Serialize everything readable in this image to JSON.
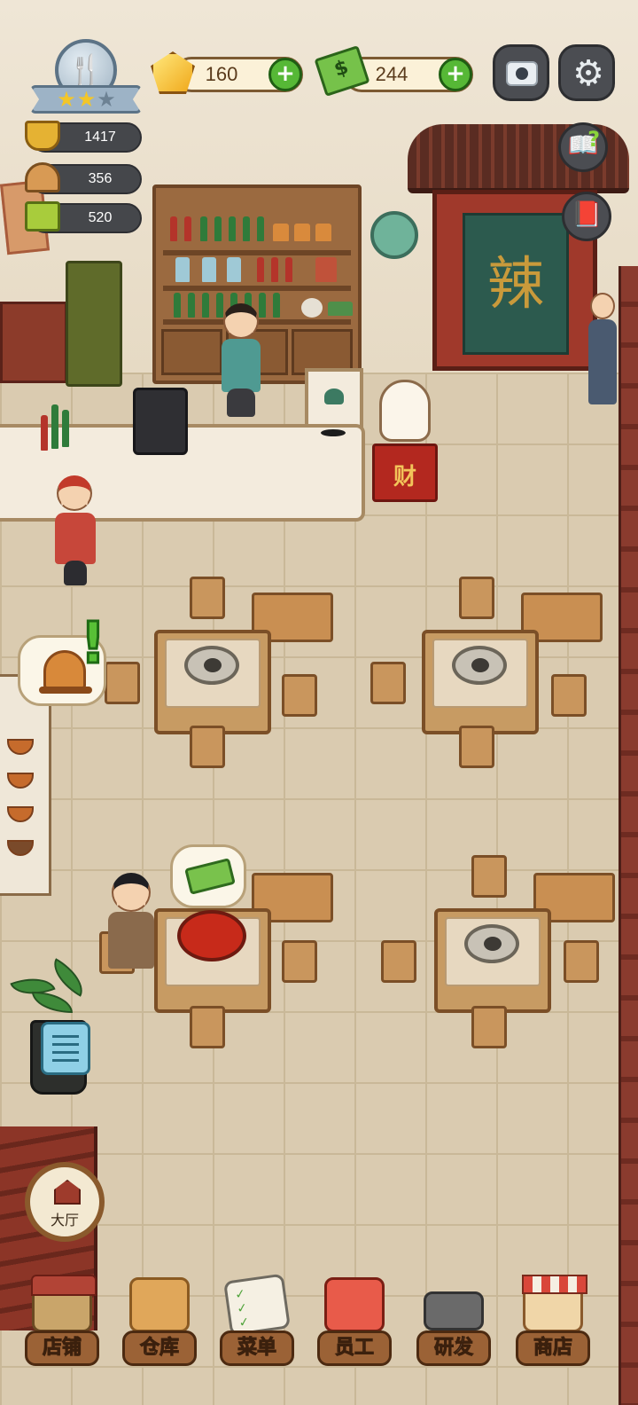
{
  "hud": {
    "gems": "160",
    "cash": "244",
    "stats": {
      "popularity": "1417",
      "dishes": "356",
      "recipes": "520"
    },
    "rank_stars_filled": 2,
    "rank_stars_total": 3
  },
  "scene": {
    "gate_sign": "辣",
    "fortune_sign": "财"
  },
  "hall_button": {
    "label": "大厅"
  },
  "nav": {
    "items": [
      {
        "label": "店铺",
        "icon": "shop-building-icon"
      },
      {
        "label": "仓库",
        "icon": "warehouse-boxes-icon"
      },
      {
        "label": "菜单",
        "icon": "menu-clipboard-icon"
      },
      {
        "label": "员工",
        "icon": "staff-chef-icon"
      },
      {
        "label": "研发",
        "icon": "research-wok-icon"
      },
      {
        "label": "商店",
        "icon": "store-stall-icon"
      }
    ]
  },
  "colors": {
    "plus_button": "#56b836",
    "nav_label_bg": "#9b6236",
    "hud_dark": "#45474b"
  }
}
